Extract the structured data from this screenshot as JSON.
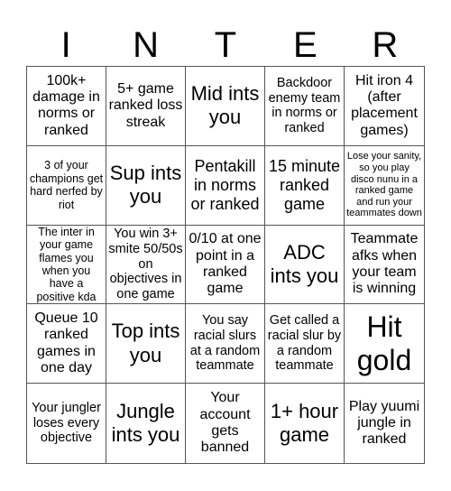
{
  "header": {
    "letters": [
      "I",
      "N",
      "T",
      "E",
      "R"
    ]
  },
  "board": {
    "cells": [
      "100k+ damage in norms or ranked",
      "5+ game ranked loss streak",
      "Mid ints you",
      "Backdoor enemy team in norms or ranked",
      "Hit iron 4 (after placement games)",
      "3 of your champions get hard nerfed by riot",
      "Sup ints you",
      "Pentakill in norms or ranked",
      "15 minute ranked game",
      "Lose your sanity, so you play disco nunu in a ranked game and run your teammates down",
      "The inter in your game flames you when you have a positive kda",
      "You win 3+ smite 50/50s on objectives in one game",
      "0/10 at one point in a ranked game",
      "ADC ints you",
      "Teammate afks when your team is winning",
      "Queue 10 ranked games in one day",
      "Top ints you",
      "You say racial slurs at a random teammate",
      "Get called a racial slur by a random teammate",
      "Hit gold",
      "Your jungler loses every objective",
      "Jungle ints you",
      "Your account gets banned",
      "1+ hour game",
      "Play yuumi jungle in ranked"
    ]
  }
}
